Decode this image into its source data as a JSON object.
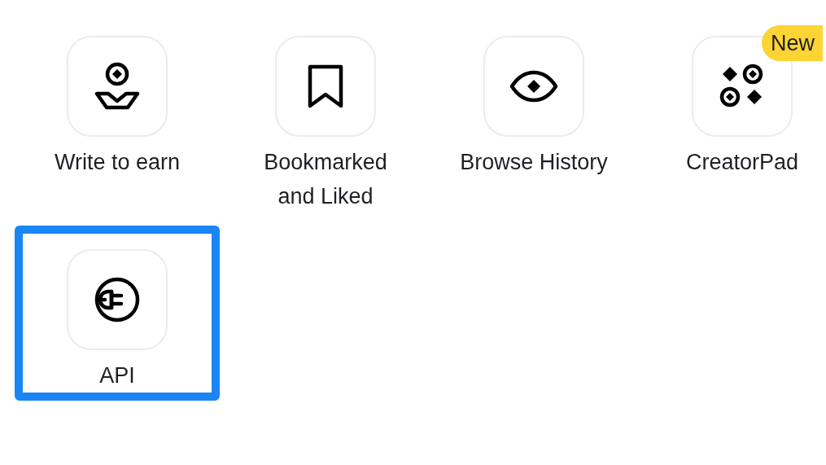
{
  "items": [
    {
      "kind": "earn",
      "label": "Write to earn",
      "highlighted": false
    },
    {
      "kind": "bookmark",
      "label": "Bookmarked\nand Liked",
      "highlighted": false
    },
    {
      "kind": "eye",
      "label": "Browse History",
      "highlighted": false
    },
    {
      "kind": "pad",
      "label": "CreatorPad",
      "badge": "New",
      "highlighted": false
    },
    {
      "kind": "api",
      "label": "API",
      "highlighted": true
    }
  ]
}
